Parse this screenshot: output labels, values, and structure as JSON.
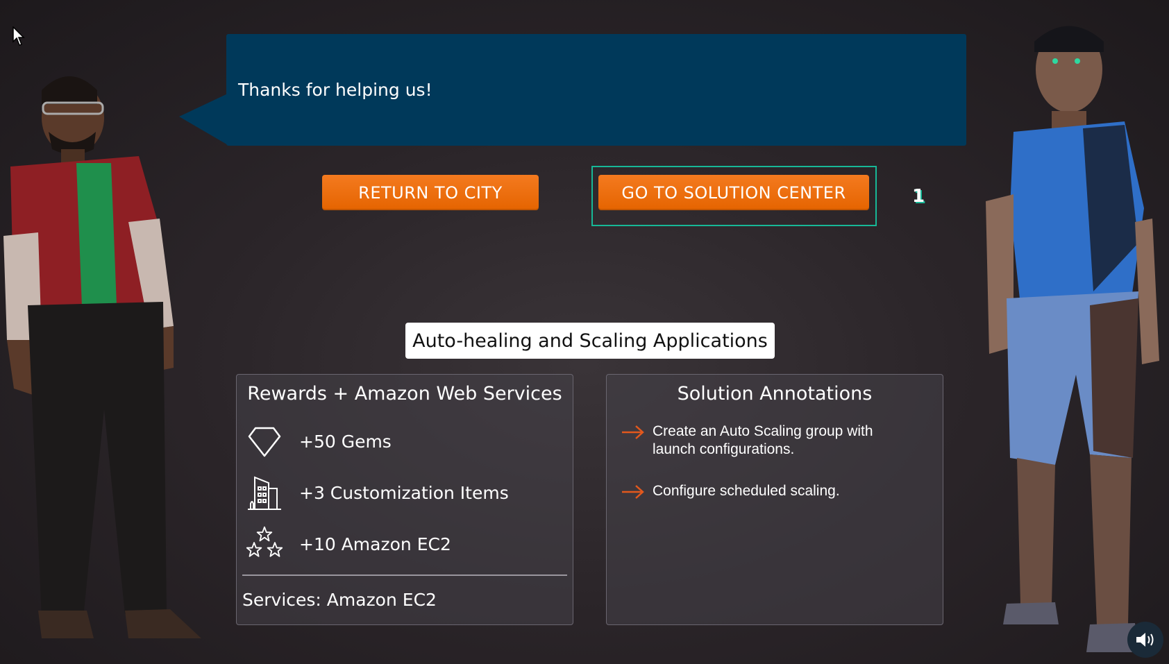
{
  "dialog": {
    "text": "Thanks for helping us!"
  },
  "buttons": {
    "return_label": "RETURN TO CITY",
    "solution_label": "GO TO SOLUTION CENTER",
    "focus_marker": "1"
  },
  "mission_title": "Auto-healing and Scaling Applications",
  "rewards": {
    "title": "Rewards + Amazon Web Services",
    "items": [
      {
        "icon": "diamond-gem-icon",
        "label": "+50 Gems"
      },
      {
        "icon": "building-icon",
        "label": "+3 Customization Items"
      },
      {
        "icon": "stars-icon",
        "label": "+10 Amazon EC2"
      }
    ],
    "services": "Services: Amazon EC2"
  },
  "annotations": {
    "title": "Solution Annotations",
    "items": [
      "Create an Auto Scaling group with launch configurations.",
      "Configure scheduled scaling."
    ]
  },
  "colors": {
    "speech_bg": "#00395a",
    "button": "#ec6f0f",
    "focus": "#17b897",
    "arrow": "#e2581d"
  },
  "icons": {
    "sound": "speaker-volume-icon",
    "cursor": "mouse-pointer-icon"
  }
}
